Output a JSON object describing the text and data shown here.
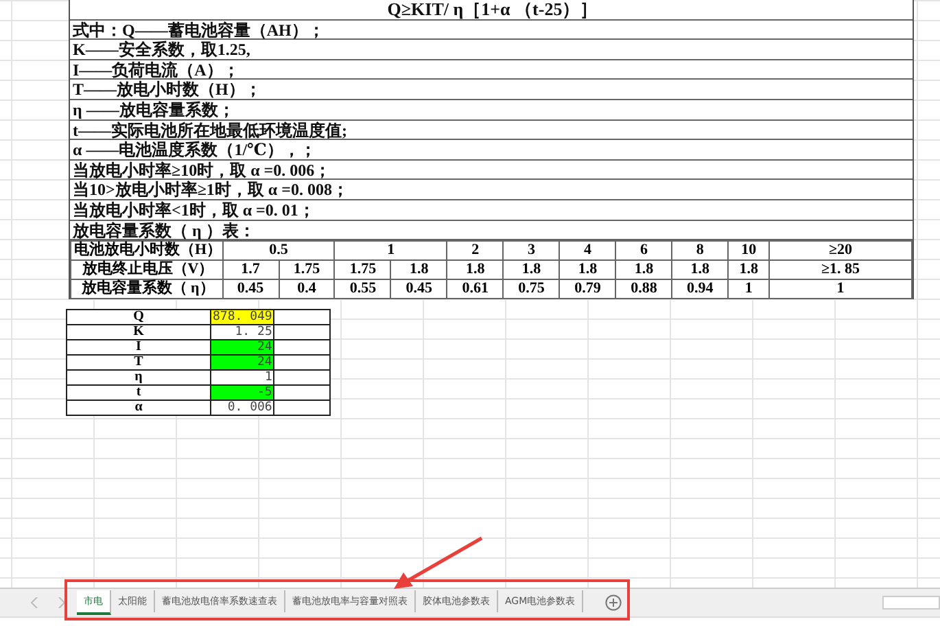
{
  "formula": "Q≥KIT/ η［1+α （t-25）］",
  "notes": [
    "式中：Q——蓄电池容量（AH）；",
    "K——安全系数，取1.25,",
    "I——负荷电流（A）；",
    "T——放电小时数（H）；",
    " η ——放电容量系数；",
    "t——实际电池所在地最低环境温度值;",
    "α ——电池温度系数（1/℃），；",
    "当放电小时率≥10时，取 α =0. 006；",
    "当10>放电小时率≥1时，取 α =0. 008；",
    "当放电小时率<1时，取 α =0. 01；",
    "放电容量系数（ η ）表："
  ],
  "coef_table": {
    "row_labels": [
      "电池放电小时数（H）",
      "放电终止电压（V）",
      "放电容量系数（ η）"
    ],
    "groups": [
      {
        "hours": "0.5",
        "entries": [
          {
            "voltage": "1.7",
            "coefficient": "0.45"
          },
          {
            "voltage": "1.75",
            "coefficient": "0.4"
          }
        ]
      },
      {
        "hours": "1",
        "entries": [
          {
            "voltage": "1.75",
            "coefficient": "0.55"
          },
          {
            "voltage": "1.8",
            "coefficient": "0.45"
          }
        ]
      },
      {
        "hours": "2",
        "entries": [
          {
            "voltage": "1.8",
            "coefficient": "0.61"
          }
        ]
      },
      {
        "hours": "3",
        "entries": [
          {
            "voltage": "1.8",
            "coefficient": "0.75"
          }
        ]
      },
      {
        "hours": "4",
        "entries": [
          {
            "voltage": "1.8",
            "coefficient": "0.79"
          }
        ]
      },
      {
        "hours": "6",
        "entries": [
          {
            "voltage": "1.8",
            "coefficient": "0.88"
          }
        ]
      },
      {
        "hours": "8",
        "entries": [
          {
            "voltage": "1.8",
            "coefficient": "0.94"
          }
        ]
      },
      {
        "hours": "10",
        "entries": [
          {
            "voltage": "1.8",
            "coefficient": "1"
          }
        ]
      },
      {
        "hours": "≥20",
        "entries": [
          {
            "voltage": "≥1. 85",
            "coefficient": "1"
          }
        ]
      }
    ]
  },
  "calc_table": [
    {
      "symbol": "Q",
      "value": "878. 049",
      "color": "#ffff00"
    },
    {
      "symbol": "K",
      "value": "1. 25"
    },
    {
      "symbol": "I",
      "value": "24",
      "color": "#00ff00"
    },
    {
      "symbol": "T",
      "value": "24",
      "color": "#00ff00"
    },
    {
      "symbol": "η",
      "value": "1"
    },
    {
      "symbol": "t",
      "value": "-5",
      "color": "#00ff00"
    },
    {
      "symbol": "α",
      "value": "0. 006"
    }
  ],
  "sheet_tabs": [
    {
      "label": "市电",
      "selected": true
    },
    {
      "label": "太阳能",
      "selected": false
    },
    {
      "label": "蓄电池放电倍率系数速查表",
      "selected": false
    },
    {
      "label": "蓄电池放电率与容量对照表",
      "selected": false
    },
    {
      "label": "胶体电池参数表",
      "selected": false
    },
    {
      "label": "AGM电池参数表",
      "selected": false
    }
  ]
}
